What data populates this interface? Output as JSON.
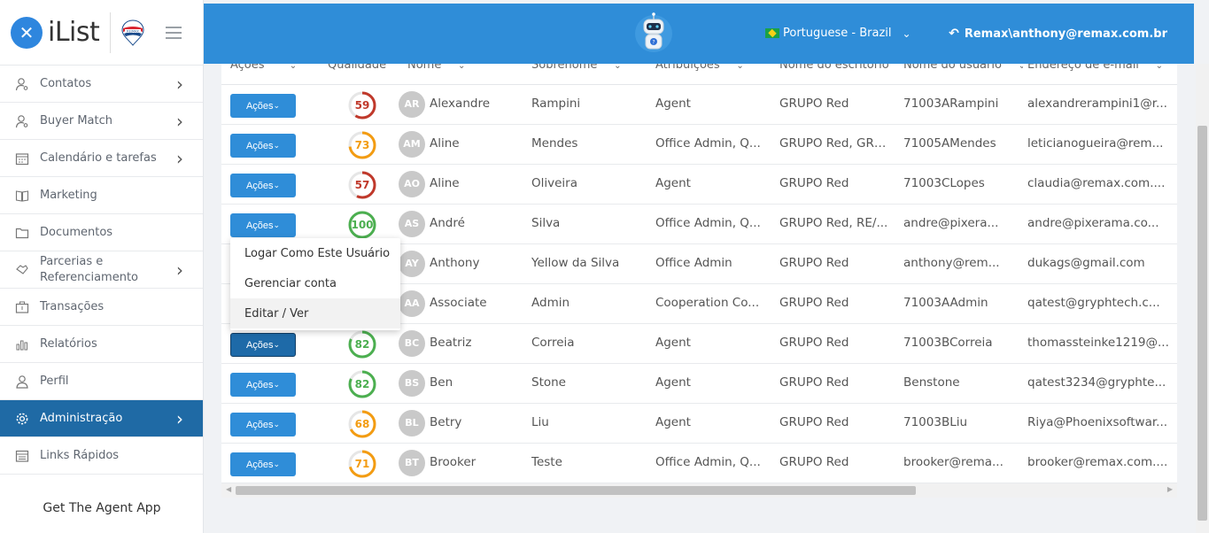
{
  "sidebar": {
    "logo_text": "iList",
    "brand_logo": "remax-balloon-logo",
    "items": [
      {
        "label": "Contatos",
        "icon": "user-search-icon",
        "chevron": true
      },
      {
        "label": "Buyer Match",
        "icon": "user-search-icon",
        "chevron": true
      },
      {
        "label": "Calendário e tarefas",
        "icon": "calendar-icon",
        "chevron": true
      },
      {
        "label": "Marketing",
        "icon": "book-icon",
        "chevron": false
      },
      {
        "label": "Documentos",
        "icon": "folder-icon",
        "chevron": false
      },
      {
        "label": "Parcerias e Referenciamento",
        "icon": "handshake-icon",
        "chevron": true
      },
      {
        "label": "Transações",
        "icon": "briefcase-icon",
        "chevron": false
      },
      {
        "label": "Relatórios",
        "icon": "bar-chart-icon",
        "chevron": false
      },
      {
        "label": "Perfil",
        "icon": "user-icon",
        "chevron": false
      },
      {
        "label": "Administração",
        "icon": "gear-icon",
        "chevron": true,
        "active": true
      },
      {
        "label": "Links Rápidos",
        "icon": "links-icon",
        "chevron": false
      }
    ],
    "get_app": "Get The Agent App"
  },
  "header": {
    "language": "Portuguese - Brazil",
    "user": "Remax\\anthony@remax.com.br",
    "colors": {
      "bar": "#2f8dd8",
      "active_nav": "#1f6aa5"
    }
  },
  "table": {
    "columns": [
      "Ações",
      "Qualidade",
      "Nome",
      "Sobrenome",
      "Atribuições",
      "Nome do escritório",
      "Nome do usuário",
      "Endereço de e-mail"
    ],
    "action_label": "Ações",
    "rows": [
      {
        "quality": "59",
        "qcolor": "#c0392b",
        "initials": "AR",
        "first": "Alexandre",
        "last": "Rampini",
        "roles": "Agent",
        "office": "GRUPO Red",
        "username": "71003ARampini",
        "email": "alexandrerampini1@r..."
      },
      {
        "quality": "73",
        "qcolor": "#f39c12",
        "initials": "AM",
        "first": "Aline",
        "last": "Mendes",
        "roles": "Office Admin, Q...",
        "office": "GRUPO Red, GRU...",
        "username": "71005AMendes",
        "email": "leticianogueira@rem..."
      },
      {
        "quality": "57",
        "qcolor": "#c0392b",
        "initials": "AO",
        "first": "Aline",
        "last": "Oliveira",
        "roles": "Agent",
        "office": "GRUPO Red",
        "username": "71003CLopes",
        "email": "claudia@remax.com...."
      },
      {
        "quality": "100",
        "qcolor": "#4caf50",
        "initials": "AS",
        "first": "André",
        "last": "Silva",
        "roles": "Office Admin, Q...",
        "office": "GRUPO Red, RE/...",
        "username": "andre@pixera...",
        "email": "andre@pixerama.co..."
      },
      {
        "quality": "",
        "qcolor": "#4caf50",
        "initials": "AY",
        "first": "Anthony",
        "last": "Yellow da Silva",
        "roles": "Office Admin",
        "office": "GRUPO Red",
        "username": "anthony@rem...",
        "email": "dukags@gmail.com"
      },
      {
        "quality": "",
        "qcolor": "#4caf50",
        "initials": "AA",
        "first": "Associate",
        "last": "Admin",
        "roles": "Cooperation Co...",
        "office": "GRUPO Red",
        "username": "71003AAdmin",
        "email": "qatest@gryphtech.c..."
      },
      {
        "quality": "82",
        "qcolor": "#4caf50",
        "initials": "BC",
        "first": "Beatriz",
        "last": "Correia",
        "roles": "Agent",
        "office": "GRUPO Red",
        "username": "71003BCorreia",
        "email": "thomassteinke1219@..."
      },
      {
        "quality": "82",
        "qcolor": "#4caf50",
        "initials": "BS",
        "first": "Ben",
        "last": "Stone",
        "roles": "Agent",
        "office": "GRUPO Red",
        "username": "Benstone",
        "email": "qatest3234@gryphte..."
      },
      {
        "quality": "68",
        "qcolor": "#f39c12",
        "initials": "BL",
        "first": "Betry",
        "last": "Liu",
        "roles": "Agent",
        "office": "GRUPO Red",
        "username": "71003BLiu",
        "email": "Riya@Phoenixsoftwar..."
      },
      {
        "quality": "71",
        "qcolor": "#f39c12",
        "initials": "BT",
        "first": "Brooker",
        "last": "Teste",
        "roles": "Office Admin, Q...",
        "office": "GRUPO Red",
        "username": "brooker@rema...",
        "email": "brooker@remax.com...."
      }
    ]
  },
  "dropdown": {
    "items": [
      "Logar Como Este Usuário",
      "Gerenciar conta",
      "Editar / Ver"
    ]
  }
}
